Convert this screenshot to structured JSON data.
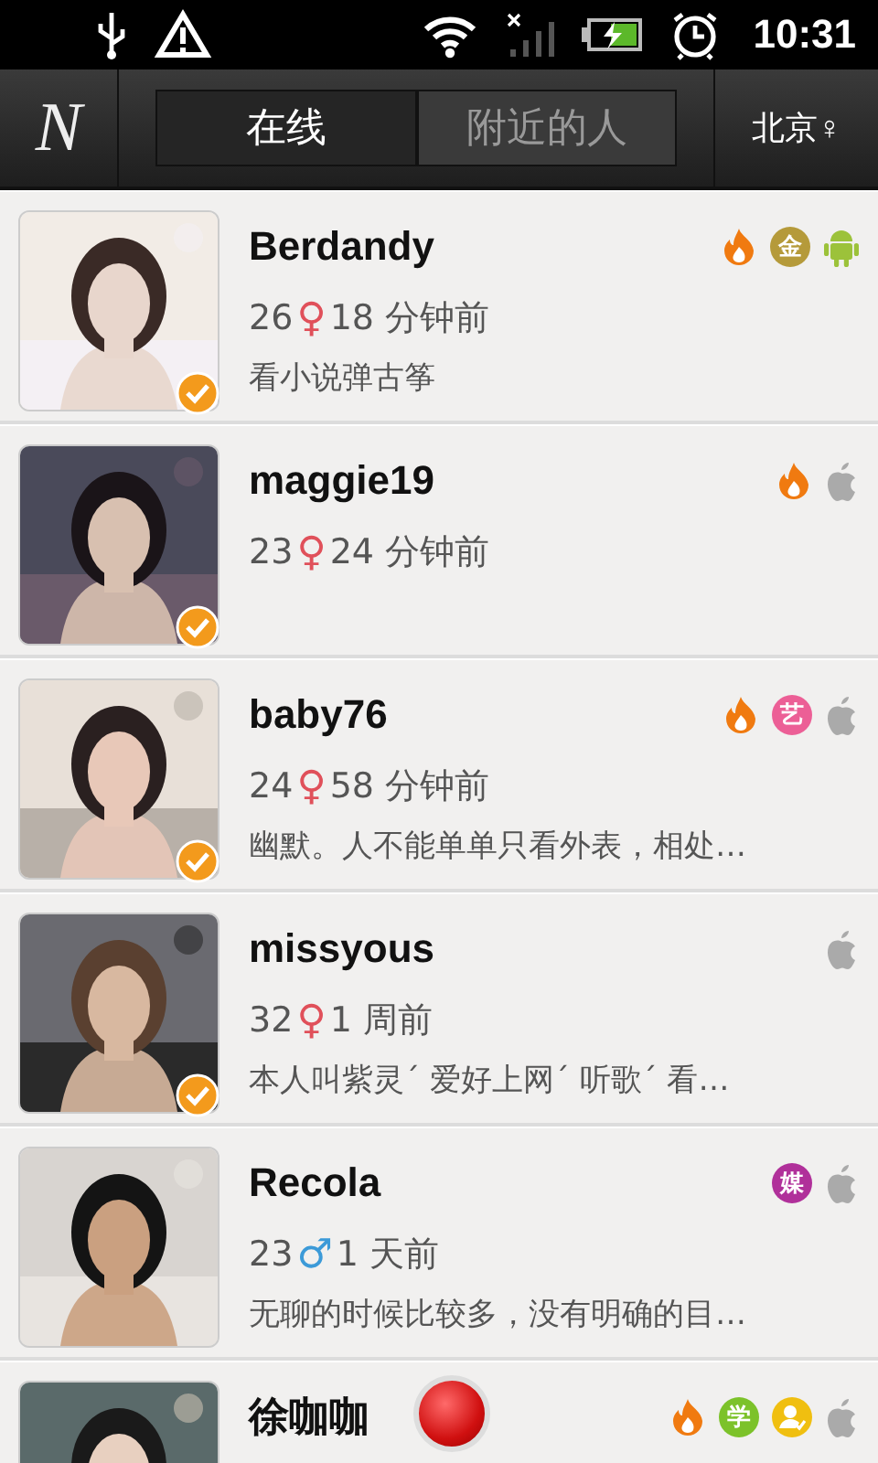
{
  "status_bar": {
    "time": "10:31"
  },
  "header": {
    "logo": "N",
    "tabs": [
      {
        "label": "在线",
        "selected": true
      },
      {
        "label": "附近的人",
        "selected": false
      }
    ],
    "location": "北京♀"
  },
  "users": [
    {
      "name": "Berdandy",
      "age": "26",
      "sex": {
        "symbol": "♀",
        "color": "#e0505a"
      },
      "last_seen": "18 分钟前",
      "bio": "看小说弹古筝",
      "verified": true,
      "badges": [
        {
          "kind": "fire"
        },
        {
          "kind": "char",
          "text": "金",
          "color": "#b59a3a"
        },
        {
          "kind": "android"
        }
      ]
    },
    {
      "name": "maggie19",
      "age": "23",
      "sex": {
        "symbol": "♀",
        "color": "#e0505a"
      },
      "last_seen": "24 分钟前",
      "verified": true,
      "badges": [
        {
          "kind": "fire"
        },
        {
          "kind": "apple"
        }
      ]
    },
    {
      "name": "baby76",
      "age": "24",
      "sex": {
        "symbol": "♀",
        "color": "#e0505a"
      },
      "last_seen": "58 分钟前",
      "bio": "幽默。人不能单单只看外表，相处…",
      "verified": true,
      "badges": [
        {
          "kind": "fire"
        },
        {
          "kind": "char",
          "text": "艺",
          "color": "#ec5f96"
        },
        {
          "kind": "apple"
        }
      ]
    },
    {
      "name": "missyous",
      "age": "32",
      "sex": {
        "symbol": "♀",
        "color": "#e0505a"
      },
      "last_seen": "1 周前",
      "bio": "本人叫紫灵´ 爱好上网´ 听歌´ 看…",
      "verified": true,
      "badges": [
        {
          "kind": "apple"
        }
      ]
    },
    {
      "name": "Recola",
      "age": "23",
      "sex": {
        "symbol": "♂",
        "color": "#3c9ad8"
      },
      "last_seen": "1 天前",
      "bio": "无聊的时候比较多，没有明确的目…",
      "verified": false,
      "badges": [
        {
          "kind": "char",
          "text": "媒",
          "color": "#b0309a"
        },
        {
          "kind": "apple"
        }
      ]
    },
    {
      "name": "徐咖咖",
      "badges": [
        {
          "kind": "fire"
        },
        {
          "kind": "char",
          "text": "学",
          "color": "#7cc22a"
        },
        {
          "kind": "person",
          "color": "#f0bf10"
        },
        {
          "kind": "apple"
        }
      ]
    }
  ],
  "floating_button": {
    "kind": "record"
  }
}
